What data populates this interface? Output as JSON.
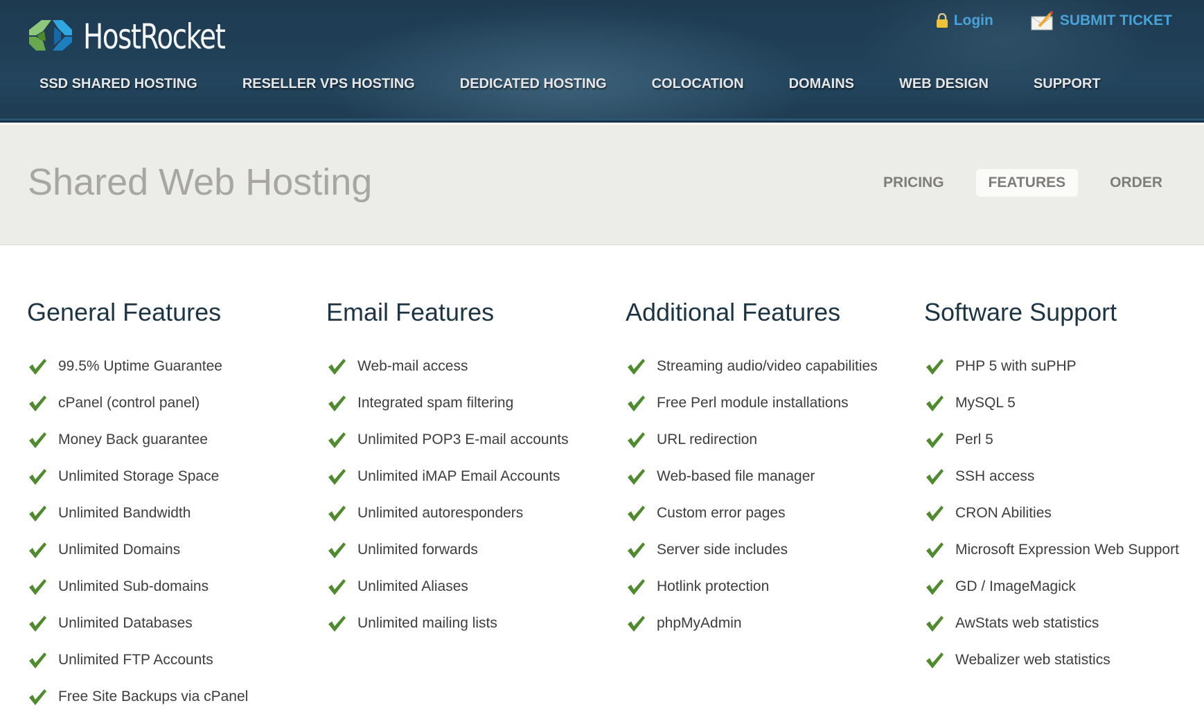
{
  "header": {
    "logo_text": "HostRocket",
    "login_label": "Login",
    "submit_ticket_label": "SUBMIT TICKET",
    "nav": [
      {
        "label": "SSD SHARED HOSTING"
      },
      {
        "label": "RESELLER VPS HOSTING"
      },
      {
        "label": "DEDICATED HOSTING"
      },
      {
        "label": "COLOCATION"
      },
      {
        "label": "DOMAINS"
      },
      {
        "label": "WEB DESIGN"
      },
      {
        "label": "SUPPORT"
      }
    ]
  },
  "subheader": {
    "title": "Shared Web Hosting",
    "tabs": [
      {
        "label": "PRICING",
        "active": false
      },
      {
        "label": "FEATURES",
        "active": true
      },
      {
        "label": "ORDER",
        "active": false
      }
    ]
  },
  "colors": {
    "accent_link": "#48a3d9",
    "check_green": "#4f8a2f",
    "heading": "#1d3445"
  },
  "columns": [
    {
      "title": "General Features",
      "items": [
        "99.5% Uptime Guarantee",
        "cPanel (control panel)",
        "Money Back guarantee",
        "Unlimited Storage Space",
        "Unlimited Bandwidth",
        "Unlimited Domains",
        "Unlimited Sub-domains",
        "Unlimited Databases",
        "Unlimited FTP Accounts",
        "Free Site Backups via cPanel"
      ]
    },
    {
      "title": "Email Features",
      "items": [
        "Web-mail access",
        "Integrated spam filtering",
        "Unlimited POP3 E-mail accounts",
        "Unlimited iMAP Email Accounts",
        "Unlimited autoresponders",
        "Unlimited forwards",
        "Unlimited Aliases",
        "Unlimited mailing lists"
      ]
    },
    {
      "title": "Additional Features",
      "items": [
        "Streaming audio/video capabilities",
        "Free Perl module installations",
        "URL redirection",
        "Web-based file manager",
        "Custom error pages",
        "Server side includes",
        "Hotlink protection",
        "phpMyAdmin"
      ]
    },
    {
      "title": "Software Support",
      "items": [
        "PHP 5 with suPHP",
        "MySQL 5",
        "Perl 5",
        "SSH access",
        "CRON Abilities",
        "Microsoft Expression Web Support",
        "GD / ImageMagick",
        "AwStats web statistics",
        "Webalizer web statistics"
      ]
    }
  ]
}
